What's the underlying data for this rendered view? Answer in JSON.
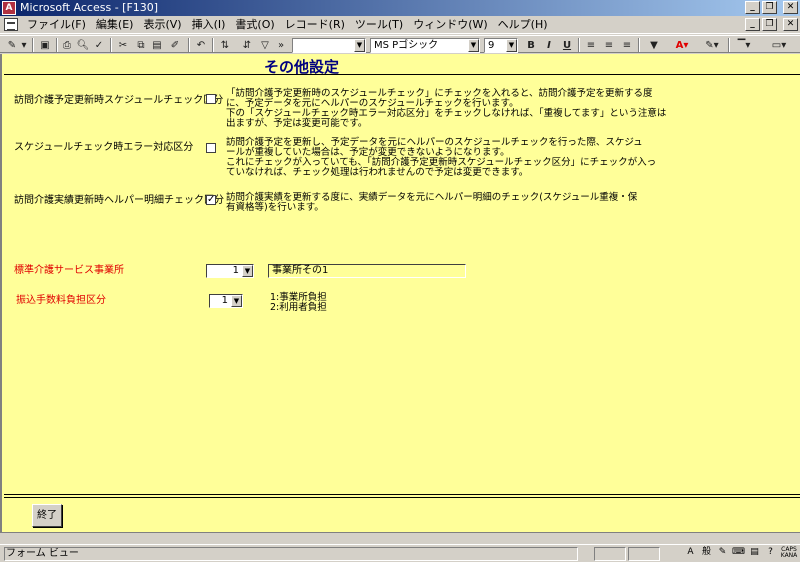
{
  "window": {
    "title": "Microsoft Access - [F130]",
    "app_icon": "access-key-icon"
  },
  "menu": {
    "items": [
      "ファイル(F)",
      "編集(E)",
      "表示(V)",
      "挿入(I)",
      "書式(O)",
      "レコード(R)",
      "ツール(T)",
      "ウィンドウ(W)",
      "ヘルプ(H)"
    ]
  },
  "toolbar": {
    "font_name": "MS Pゴシック",
    "font_size": "9",
    "bold": "B",
    "italic": "I",
    "underline": "U"
  },
  "form": {
    "title": "その他設定",
    "settings": [
      {
        "label": "訪問介護予定更新時スケジュールチェック区分",
        "checked": false,
        "check_mark": "",
        "description": "「訪問介護予定更新時のスケジュールチェック」にチェックを入れると、訪問介護予定を更新する度\nに、予定データを元にヘルパーのスケジュールチェックを行います。\n下の「スケジュールチェック時エラー対応区分」をチェックしなければ、「重複してます」という注意は\n出ますが、予定は変更可能です。"
      },
      {
        "label": "スケジュールチェック時エラー対応区分",
        "checked": false,
        "check_mark": "",
        "description": "訪問介護予定を更新し、予定データを元にヘルパーのスケジュールチェックを行った際、スケジュ\nールが重複していた場合は、予定が変更できないようになります。\nこれにチェックが入っていても、「訪問介護予定更新時スケジュールチェック区分」にチェックが入っ\nていなければ、チェック処理は行われませんので予定は変更できます。"
      },
      {
        "label": "訪問介護実績更新時ヘルパー明細チェック区分",
        "checked": true,
        "check_mark": "✓",
        "description": "訪問介護実績を更新する度に、実績データを元にヘルパー明細のチェック(スケジュール重複・保\n有資格等)を行います。"
      }
    ],
    "office": {
      "label": "標準介護サービス事業所",
      "value": "1",
      "name": "事業所その1"
    },
    "fee": {
      "label": "振込手数料負担区分",
      "value": "1",
      "options_note": "1:事業所負担\n2:利用者負担"
    },
    "exit_label": "終了"
  },
  "status": {
    "text": "フォーム ビュー",
    "tray": [
      "A",
      "般",
      "CAPS\nKANA"
    ]
  },
  "colors": {
    "form_bg": "#ffff99",
    "title": "#000080",
    "required_label": "#e00000"
  }
}
